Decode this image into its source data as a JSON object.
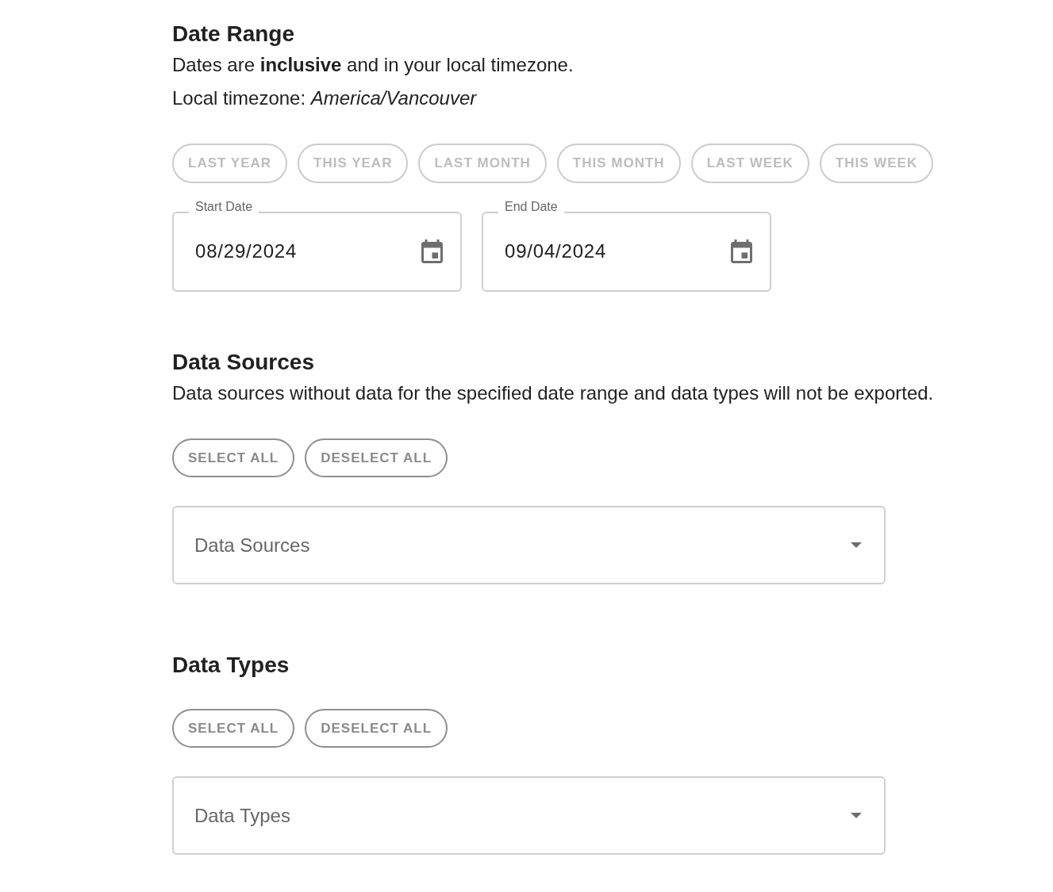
{
  "date_range": {
    "title": "Date Range",
    "note": "Dates are **inclusive** and in your local timezone.",
    "timezone_note": "Local timezone: *America/Vancouver*",
    "presets": [
      {
        "label": "LAST YEAR",
        "disabled": true
      },
      {
        "label": "THIS YEAR",
        "disabled": true
      },
      {
        "label": "LAST MONTH",
        "disabled": true
      },
      {
        "label": "THIS MONTH",
        "disabled": true
      },
      {
        "label": "LAST WEEK",
        "disabled": true
      },
      {
        "label": "THIS WEEK",
        "disabled": true
      }
    ],
    "fields": [
      {
        "label": "Start Date",
        "value": "08/29/2024"
      },
      {
        "label": "End Date",
        "value": "09/04/2024"
      }
    ]
  },
  "data_sources": {
    "title": "Data Sources",
    "note": "Data sources without data for the specified date range and data types will not be exported.",
    "select_all": {
      "label": "SELECT ALL",
      "disabled": false
    },
    "deselect_all": {
      "label": "DESELECT ALL",
      "disabled": false
    },
    "select": {
      "placeholder": "Data Sources"
    }
  },
  "data_types": {
    "title": "Data Types",
    "select_all": {
      "label": "SELECT ALL",
      "disabled": false
    },
    "deselect_all": {
      "label": "DESELECT ALL",
      "disabled": false
    },
    "select": {
      "placeholder": "Data Types"
    }
  }
}
